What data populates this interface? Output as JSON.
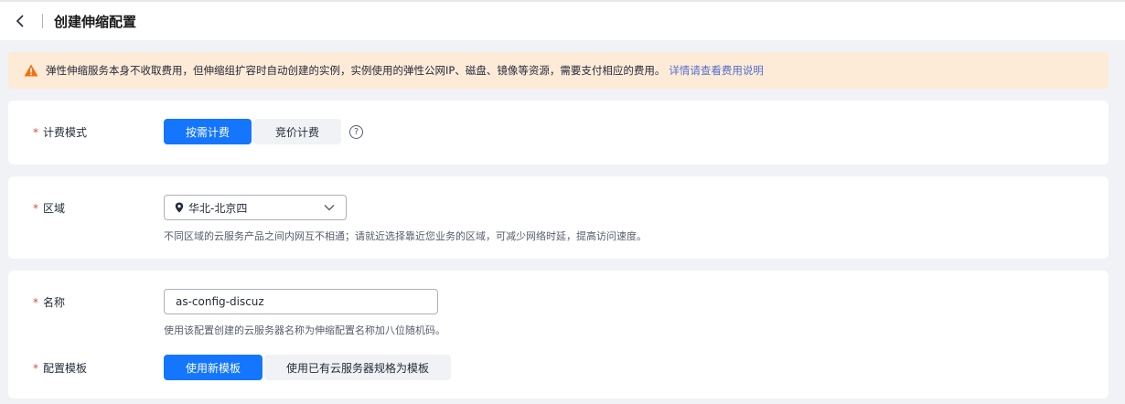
{
  "header": {
    "title": "创建伸缩配置"
  },
  "alert": {
    "text": "弹性伸缩服务本身不收取费用，但伸缩组扩容时自动创建的实例，实例使用的弹性公网IP、磁盘、镜像等资源，需要支付相应的费用。",
    "link": "详情请查看费用说明"
  },
  "billing": {
    "required_mark": "*",
    "label": "计费模式",
    "options": [
      "按需计费",
      "竞价计费"
    ],
    "selected": "按需计费",
    "help_glyph": "?"
  },
  "region": {
    "required_mark": "*",
    "label": "区域",
    "value": "华北-北京四",
    "hint": "不同区域的云服务产品之间内网互不相通；请就近选择靠近您业务的区域，可减少网络时延，提高访问速度。"
  },
  "name": {
    "required_mark": "*",
    "label": "名称",
    "value": "as-config-discuz",
    "hint": "使用该配置创建的云服务器名称为伸缩配置名称加八位随机码。"
  },
  "template": {
    "required_mark": "*",
    "label": "配置模板",
    "options": [
      "使用新模板",
      "使用已有云服务器规格为模板"
    ],
    "selected": "使用新模板"
  },
  "colors": {
    "primary": "#1476ff",
    "required": "#e54545",
    "alert_bg": "#fdebd8",
    "warning": "#f66f0f",
    "link": "#526ecc"
  },
  "icons": {
    "back": "chevron-left-icon",
    "warning": "warning-triangle-icon",
    "help": "question-circle-icon",
    "location": "location-pin-icon",
    "dropdown": "chevron-down-icon"
  }
}
